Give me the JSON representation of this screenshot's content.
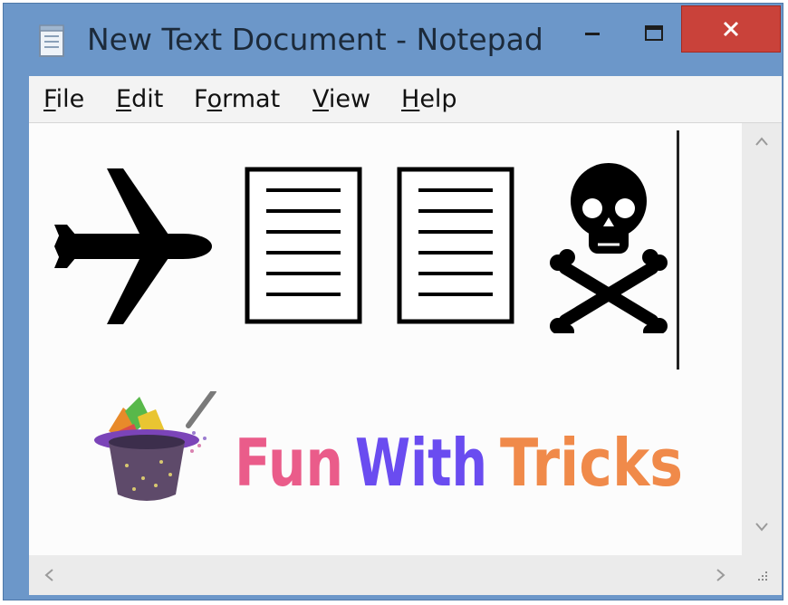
{
  "window": {
    "title": "New Text Document - Notepad",
    "colors": {
      "frame": "#6c97c9",
      "close": "#c9423a"
    }
  },
  "menubar": {
    "items": [
      {
        "pre": "",
        "key": "F",
        "post": "ile"
      },
      {
        "pre": "",
        "key": "E",
        "post": "dit"
      },
      {
        "pre": "F",
        "key": "o",
        "post": "rmat"
      },
      {
        "pre": "",
        "key": "V",
        "post": "iew"
      },
      {
        "pre": "",
        "key": "H",
        "post": "elp"
      }
    ]
  },
  "document": {
    "symbols": [
      "airplane-icon",
      "page-icon",
      "page-icon",
      "skull-crossbones-icon"
    ]
  },
  "logo": {
    "word1": "Fun",
    "word2": "With",
    "word3": "Tricks",
    "colors": {
      "word1": "#ea5c8a",
      "word2": "#6a4cf0",
      "word3": "#f08a4a"
    }
  }
}
